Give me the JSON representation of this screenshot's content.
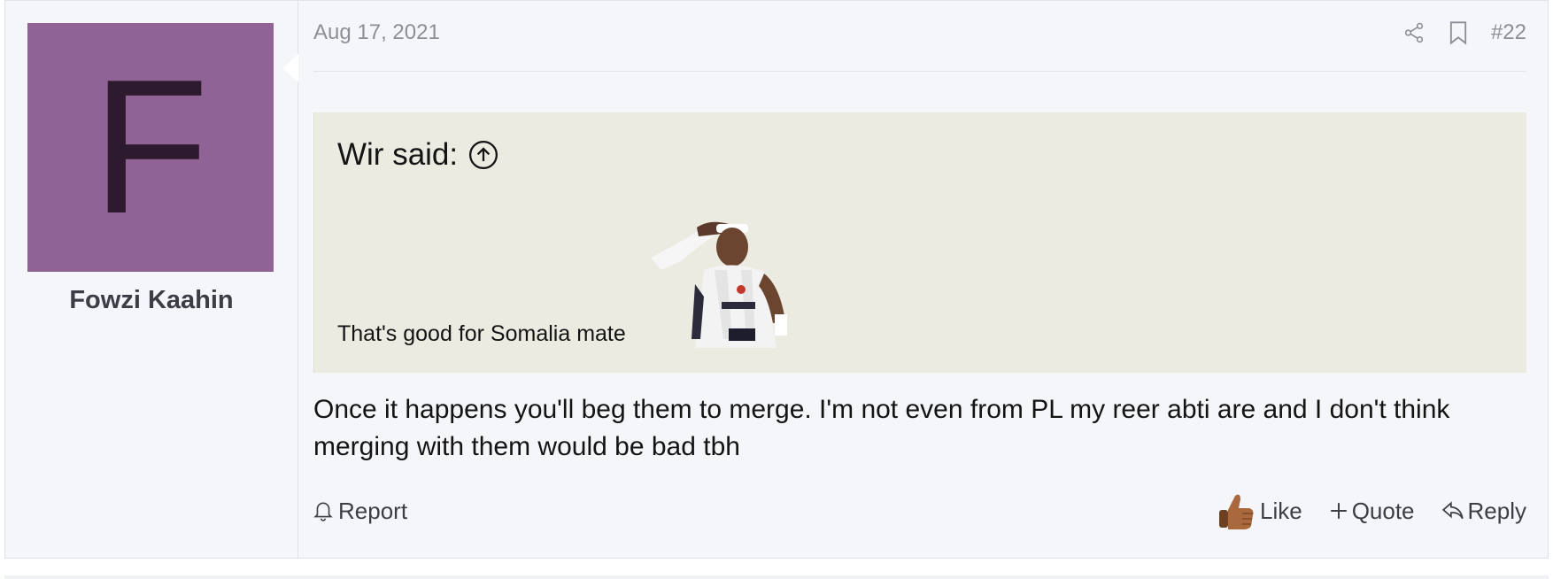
{
  "post": {
    "date": "Aug 17, 2021",
    "post_number": "#22",
    "share_icon": "share-icon",
    "bookmark_icon": "bookmark-icon"
  },
  "user": {
    "avatar_letter": "F",
    "avatar_color": "#8f6494",
    "name": "Fowzi Kaahin"
  },
  "quote": {
    "title": "Wir said:",
    "jump_icon": "arrow-up-circle-icon",
    "text": "That's good for Somalia mate",
    "background": "#ebebe1"
  },
  "message": {
    "text": "Once it happens you'll beg them to merge. I'm not even from PL my reer abti are and I don't think merging with them would be bad tbh"
  },
  "footer": {
    "report_label": "Report",
    "like_label": "Like",
    "quote_label": "Quote",
    "reply_label": "Reply"
  }
}
